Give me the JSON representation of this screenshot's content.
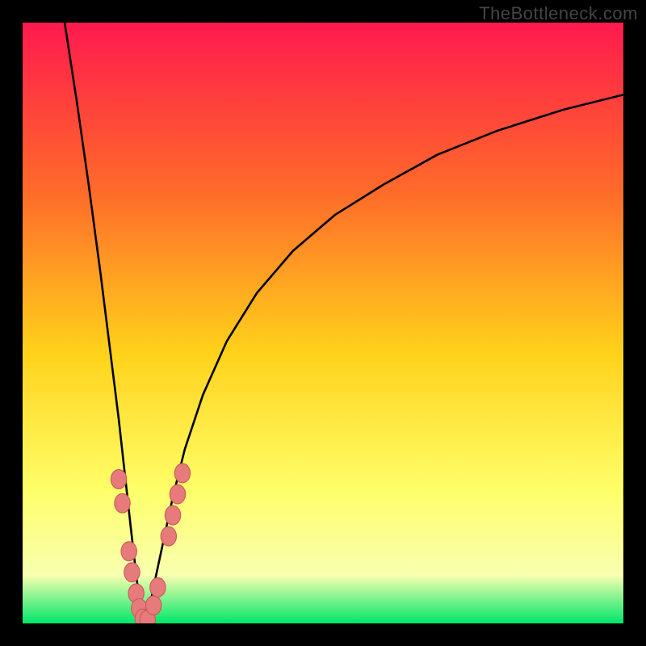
{
  "watermark": "TheBottleneck.com",
  "colors": {
    "frame": "#000000",
    "gradient_top": "#ff1a4d",
    "gradient_mid_upper": "#ff6a2a",
    "gradient_mid": "#ffd21a",
    "gradient_mid_lower": "#ffff6a",
    "gradient_lower": "#f8ffb0",
    "gradient_bottom": "#00e66a",
    "curve": "#000000",
    "marker_fill": "#e77a7a",
    "marker_stroke": "#c85a5a"
  },
  "chart_data": {
    "type": "line",
    "title": "",
    "xlabel": "",
    "ylabel": "",
    "xlim": [
      0,
      100
    ],
    "ylim": [
      0,
      100
    ],
    "curve_left": {
      "x": [
        7,
        9,
        11,
        13,
        14.5,
        16,
        17,
        18,
        18.8,
        19.4,
        19.8,
        20.2
      ],
      "y": [
        100,
        87,
        73,
        58,
        46,
        34,
        25,
        16,
        9,
        4,
        1.5,
        0.2
      ]
    },
    "curve_right": {
      "x": [
        20.2,
        21,
        22,
        23.5,
        25,
        27,
        30,
        34,
        39,
        45,
        52,
        60,
        69,
        79,
        90,
        100
      ],
      "y": [
        0.2,
        2,
        7,
        14,
        21,
        29,
        38,
        47,
        55,
        62,
        68,
        73,
        78,
        82,
        85.5,
        88
      ]
    },
    "markers": [
      {
        "x": 16.0,
        "y": 24.0
      },
      {
        "x": 16.6,
        "y": 20.0
      },
      {
        "x": 17.7,
        "y": 12.0
      },
      {
        "x": 18.2,
        "y": 8.5
      },
      {
        "x": 18.9,
        "y": 5.0
      },
      {
        "x": 19.4,
        "y": 2.5
      },
      {
        "x": 20.0,
        "y": 0.8
      },
      {
        "x": 20.8,
        "y": 0.6
      },
      {
        "x": 21.8,
        "y": 3.0
      },
      {
        "x": 22.5,
        "y": 6.0
      },
      {
        "x": 24.3,
        "y": 14.5
      },
      {
        "x": 25.0,
        "y": 18.0
      },
      {
        "x": 25.8,
        "y": 21.5
      },
      {
        "x": 26.6,
        "y": 25.0
      }
    ]
  }
}
